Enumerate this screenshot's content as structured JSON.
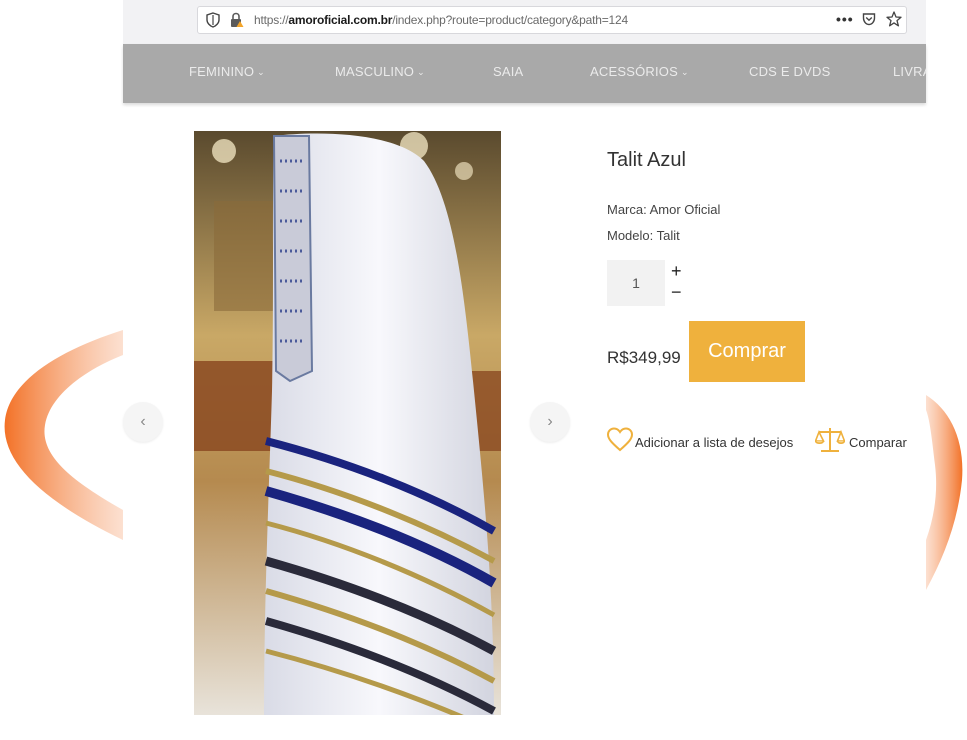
{
  "browser": {
    "url_prefix": "https://",
    "url_host": "amoroficial.com.br",
    "url_path": "/index.php?route=product/category&path=124",
    "more_icon": "more-icon",
    "pocket_icon": "pocket-icon",
    "bookmark_icon": "star-icon"
  },
  "nav": {
    "items": [
      {
        "label": "FEMININO",
        "has_dropdown": true
      },
      {
        "label": "MASCULINO",
        "has_dropdown": true
      },
      {
        "label": "SAIA",
        "has_dropdown": false
      },
      {
        "label": "ACESSÓRIOS",
        "has_dropdown": true
      },
      {
        "label": "CDS E DVDS",
        "has_dropdown": false
      },
      {
        "label": "LIVRA",
        "has_dropdown": false
      }
    ],
    "chevron": "⌄"
  },
  "carousel": {
    "prev": "‹",
    "next": "›"
  },
  "product": {
    "title": "Talit Azul",
    "brand": "Marca: Amor Oficial",
    "model": "Modelo: Talit",
    "quantity": "1",
    "plus": "+",
    "minus": "−",
    "price": "R$349,99",
    "buy_label": "Comprar",
    "wishlist_label": "Adicionar a lista de desejos",
    "compare_label": "Comparar"
  },
  "colors": {
    "accent": "#efb13d",
    "nav_bg": "#a9a9a9",
    "swoosh": "#f2792a"
  }
}
